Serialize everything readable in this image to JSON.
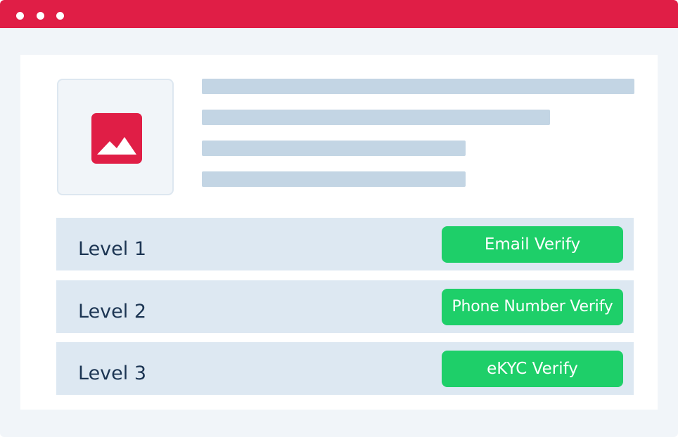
{
  "window": {
    "titlebar_color": "#e01e46",
    "window_controls": [
      "dot-icon",
      "dot-icon",
      "dot-icon"
    ]
  },
  "profile": {
    "thumbnail_icon": "image-icon",
    "text_placeholder_lines": 4
  },
  "levels": [
    {
      "label": "Level 1",
      "button_label": "Email Verify"
    },
    {
      "label": "Level 2",
      "button_label": "Phone Number Verify"
    },
    {
      "label": "Level 3",
      "button_label": "eKYC Verify"
    }
  ],
  "colors": {
    "accent": "#e01e46",
    "button": "#1ecf69",
    "row_background": "#dde8f2",
    "label_text": "#1c3553",
    "placeholder_line": "#c3d5e4"
  }
}
